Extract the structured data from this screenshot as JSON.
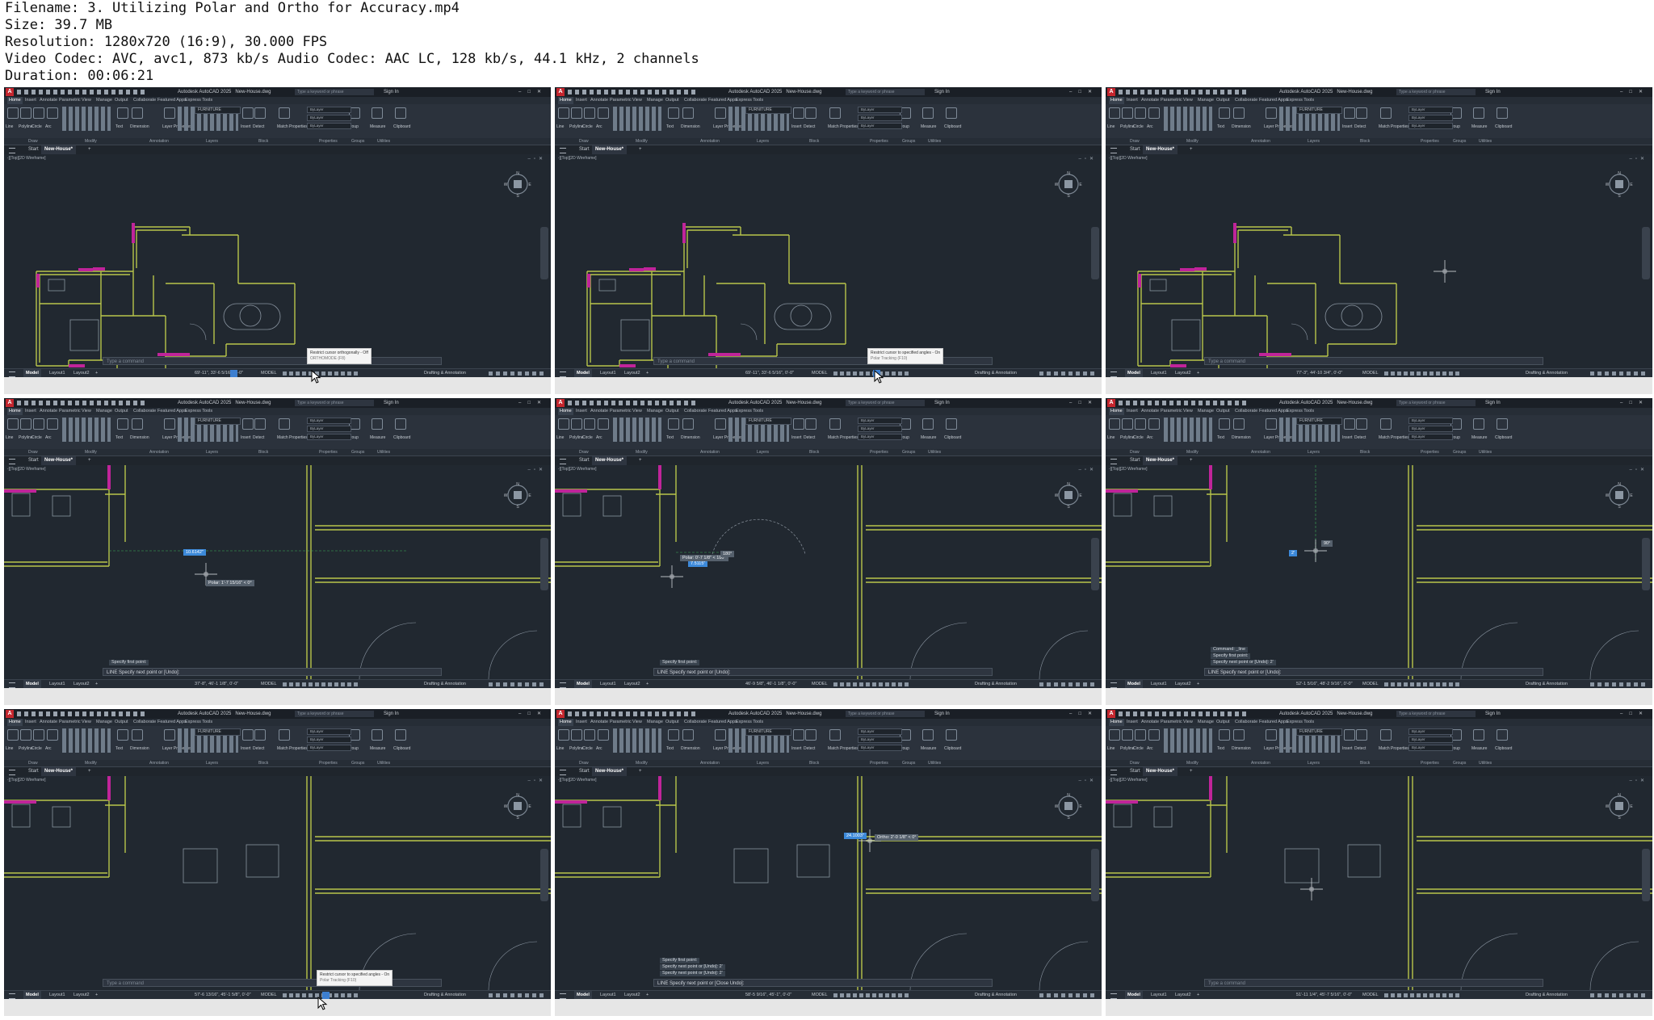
{
  "header": {
    "filename": "Filename: 3. Utilizing Polar and Ortho for Accuracy.mp4",
    "size": "Size: 39.7 MB",
    "resolution": "Resolution: 1280x720 (16:9), 30.000 FPS",
    "codec": "Video Codec: AVC, avc1, 873 kb/s Audio Codec: AAC LC, 128 kb/s, 44.1 kHz, 2 channels",
    "duration": "Duration: 00:06:21"
  },
  "app": {
    "title": "Autodesk AutoCAD 2025",
    "file": "New-House.dwg",
    "search_placeholder": "Type a keyword or phrase",
    "sign_in": "Sign In",
    "ribbon_tabs": [
      "Home",
      "Insert",
      "Annotate",
      "Parametric",
      "View",
      "Manage",
      "Output",
      "Collaborate",
      "Featured Apps",
      "Express Tools"
    ],
    "ribbon_tools": [
      "Line",
      "Polyline",
      "Circle",
      "Arc",
      "Text",
      "Dimension",
      "Layer Properties",
      "Insert",
      "Detect",
      "Match Properties",
      "Group",
      "Measure",
      "Clipboard"
    ],
    "layer_name": "FURNITURE",
    "bylayer": "ByLayer",
    "panel_names": [
      "Draw",
      "Modify",
      "Annotation",
      "Layers",
      "Block",
      "Properties",
      "Groups",
      "Utilities"
    ],
    "start_tab": "Start",
    "file_tab": "New-House*",
    "viewport_label": "-][Top][2D Wireframe]",
    "compass": {
      "n": "N",
      "s": "S",
      "e": "E",
      "w": "W"
    },
    "layout_tabs": {
      "model": "Model",
      "layout1": "Layout1",
      "layout2": "Layout2"
    },
    "status_model": "MODEL",
    "workspace": "Drafting & Annotation",
    "cmd_placeholder": "Type a command"
  },
  "colors": {
    "wall": "#b9c54a",
    "door": "#c0249a",
    "accent": "#3d7fd0",
    "viewport_bg": "#212830"
  },
  "frames": [
    {
      "coords": "69'-11\", 33'-6 5/16\", 0'-0\"",
      "cmd": "",
      "tooltip_title": "Restrict cursor orthogonally - Off",
      "tooltip_sub": "ORTHOMODE (F8)"
    },
    {
      "coords": "69'-11\", 33'-6 5/16\", 0'-0\"",
      "cmd": "",
      "tooltip_title": "Restrict cursor to specified angles - On",
      "tooltip_sub": "Polar Tracking (F10)"
    },
    {
      "coords": "77'-3\", 44'-10 3/4\", 0'-0\"",
      "cmd": ""
    },
    {
      "coords": "37'-8\", 46'-1 1/8\", 0'-0\"",
      "cmd": "LINE Specify next point or [Undo]:",
      "log": [
        "Specify first point:"
      ],
      "dyn_input": "10.6142\"",
      "dyn_tip": "Polar: 1'-7 15/16\" < 0°"
    },
    {
      "coords": "46'-9 5/8\", 46'-1 1/8\", 0'-0\"",
      "cmd": "LINE Specify next point or [Undo]:",
      "log": [
        "Specify first point:"
      ],
      "dyn_input": "7.5115\"",
      "dyn_tip": "Polar: 0'-7 1/8\" < 180°",
      "angle_tip": "180°"
    },
    {
      "coords": "52'-1 5/16\", 48'-2 9/16\", 0'-0\"",
      "cmd": "LINE Specify next point or [Undo]:",
      "log": [
        "Command: _line",
        "Specify first point:",
        "Specify next point or [Undo]: 2'"
      ],
      "dyn_input": "2'",
      "angle_tip": "90°"
    },
    {
      "coords": "57'-6 13/16\", 45'-1 5/8\", 0'-0\"",
      "cmd": "",
      "tooltip_title": "Restrict cursor to specified angles - On",
      "tooltip_sub": "Polar Tracking (F10)"
    },
    {
      "coords": "58'-5 9/16\", 45'-1\", 0'-0\"",
      "cmd": "LINE Specify next point or [Close Undo]:",
      "log": [
        "Specify first point:",
        "Specify next point or [Undo]: 2'",
        "Specify next point or [Undo]: 2'"
      ],
      "dyn_input": "24.1003\"",
      "dyn_tip": "Ortho: 2'-0 1/8\" < 0°"
    },
    {
      "coords": "51'-11 1/4\", 45'-7 5/16\", 0'-0\"",
      "cmd": ""
    }
  ]
}
